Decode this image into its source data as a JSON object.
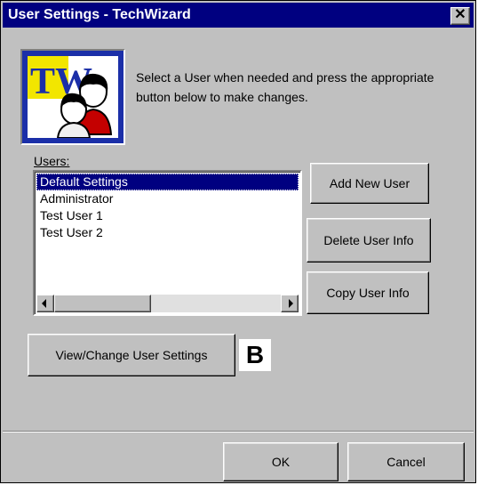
{
  "window": {
    "title": "User Settings - TechWizard",
    "close_glyph": "✕"
  },
  "logo": {
    "text": "TW",
    "icon": "techwizard-users-logo"
  },
  "instructions": "Select a User when needed and press the appropriate button below to make changes.",
  "users_label": "Users:",
  "users": [
    {
      "name": "Default Settings",
      "selected": true
    },
    {
      "name": "Administrator",
      "selected": false
    },
    {
      "name": "Test User 1",
      "selected": false
    },
    {
      "name": "Test User 2",
      "selected": false
    }
  ],
  "buttons": {
    "add_new_user": "Add New User",
    "delete_user_info": "Delete User Info",
    "copy_user_info": "Copy User Info",
    "view_change_user_settings": "View/Change User Settings",
    "ok": "OK",
    "cancel": "Cancel"
  },
  "annotation": "B",
  "colors": {
    "titlebar": "#000080",
    "selection": "#000080",
    "face": "#c0c0c0"
  }
}
